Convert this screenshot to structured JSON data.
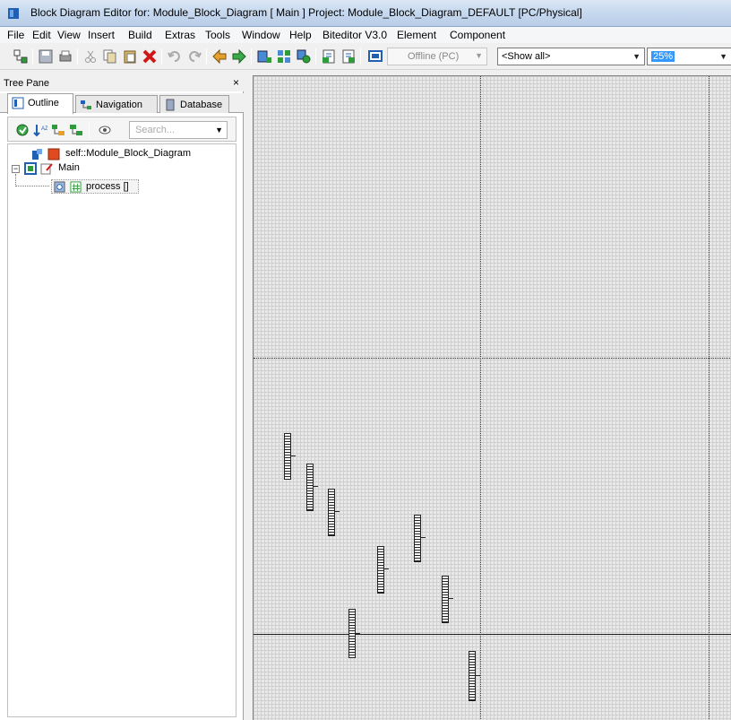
{
  "window": {
    "title": "Block Diagram Editor for: Module_Block_Diagram [ Main ] Project: Module_Block_Diagram_DEFAULT [PC/Physical]"
  },
  "menu": [
    "File",
    "Edit",
    "View",
    "Insert",
    "Build",
    "Extras",
    "Tools",
    "Window",
    "Help",
    "Biteditor V3.0",
    "Element",
    "Component"
  ],
  "toolbar": {
    "offline_label": "Offline (PC)",
    "filter_value": "<Show all>",
    "zoom_value": "25%"
  },
  "tree_pane": {
    "title": "Tree Pane",
    "close_glyph": "×",
    "tabs": [
      {
        "label": "Outline",
        "active": true
      },
      {
        "label": "Navigation",
        "active": false
      },
      {
        "label": "Database",
        "active": false
      }
    ],
    "search_placeholder": "Search...",
    "nodes": [
      {
        "label": "self::Module_Block_Diagram"
      },
      {
        "label": "Main",
        "expander": "−"
      },
      {
        "label": "process []"
      }
    ]
  },
  "colors": {
    "accent": "#3399ff",
    "canvas_bg": "#e9e9e9"
  }
}
